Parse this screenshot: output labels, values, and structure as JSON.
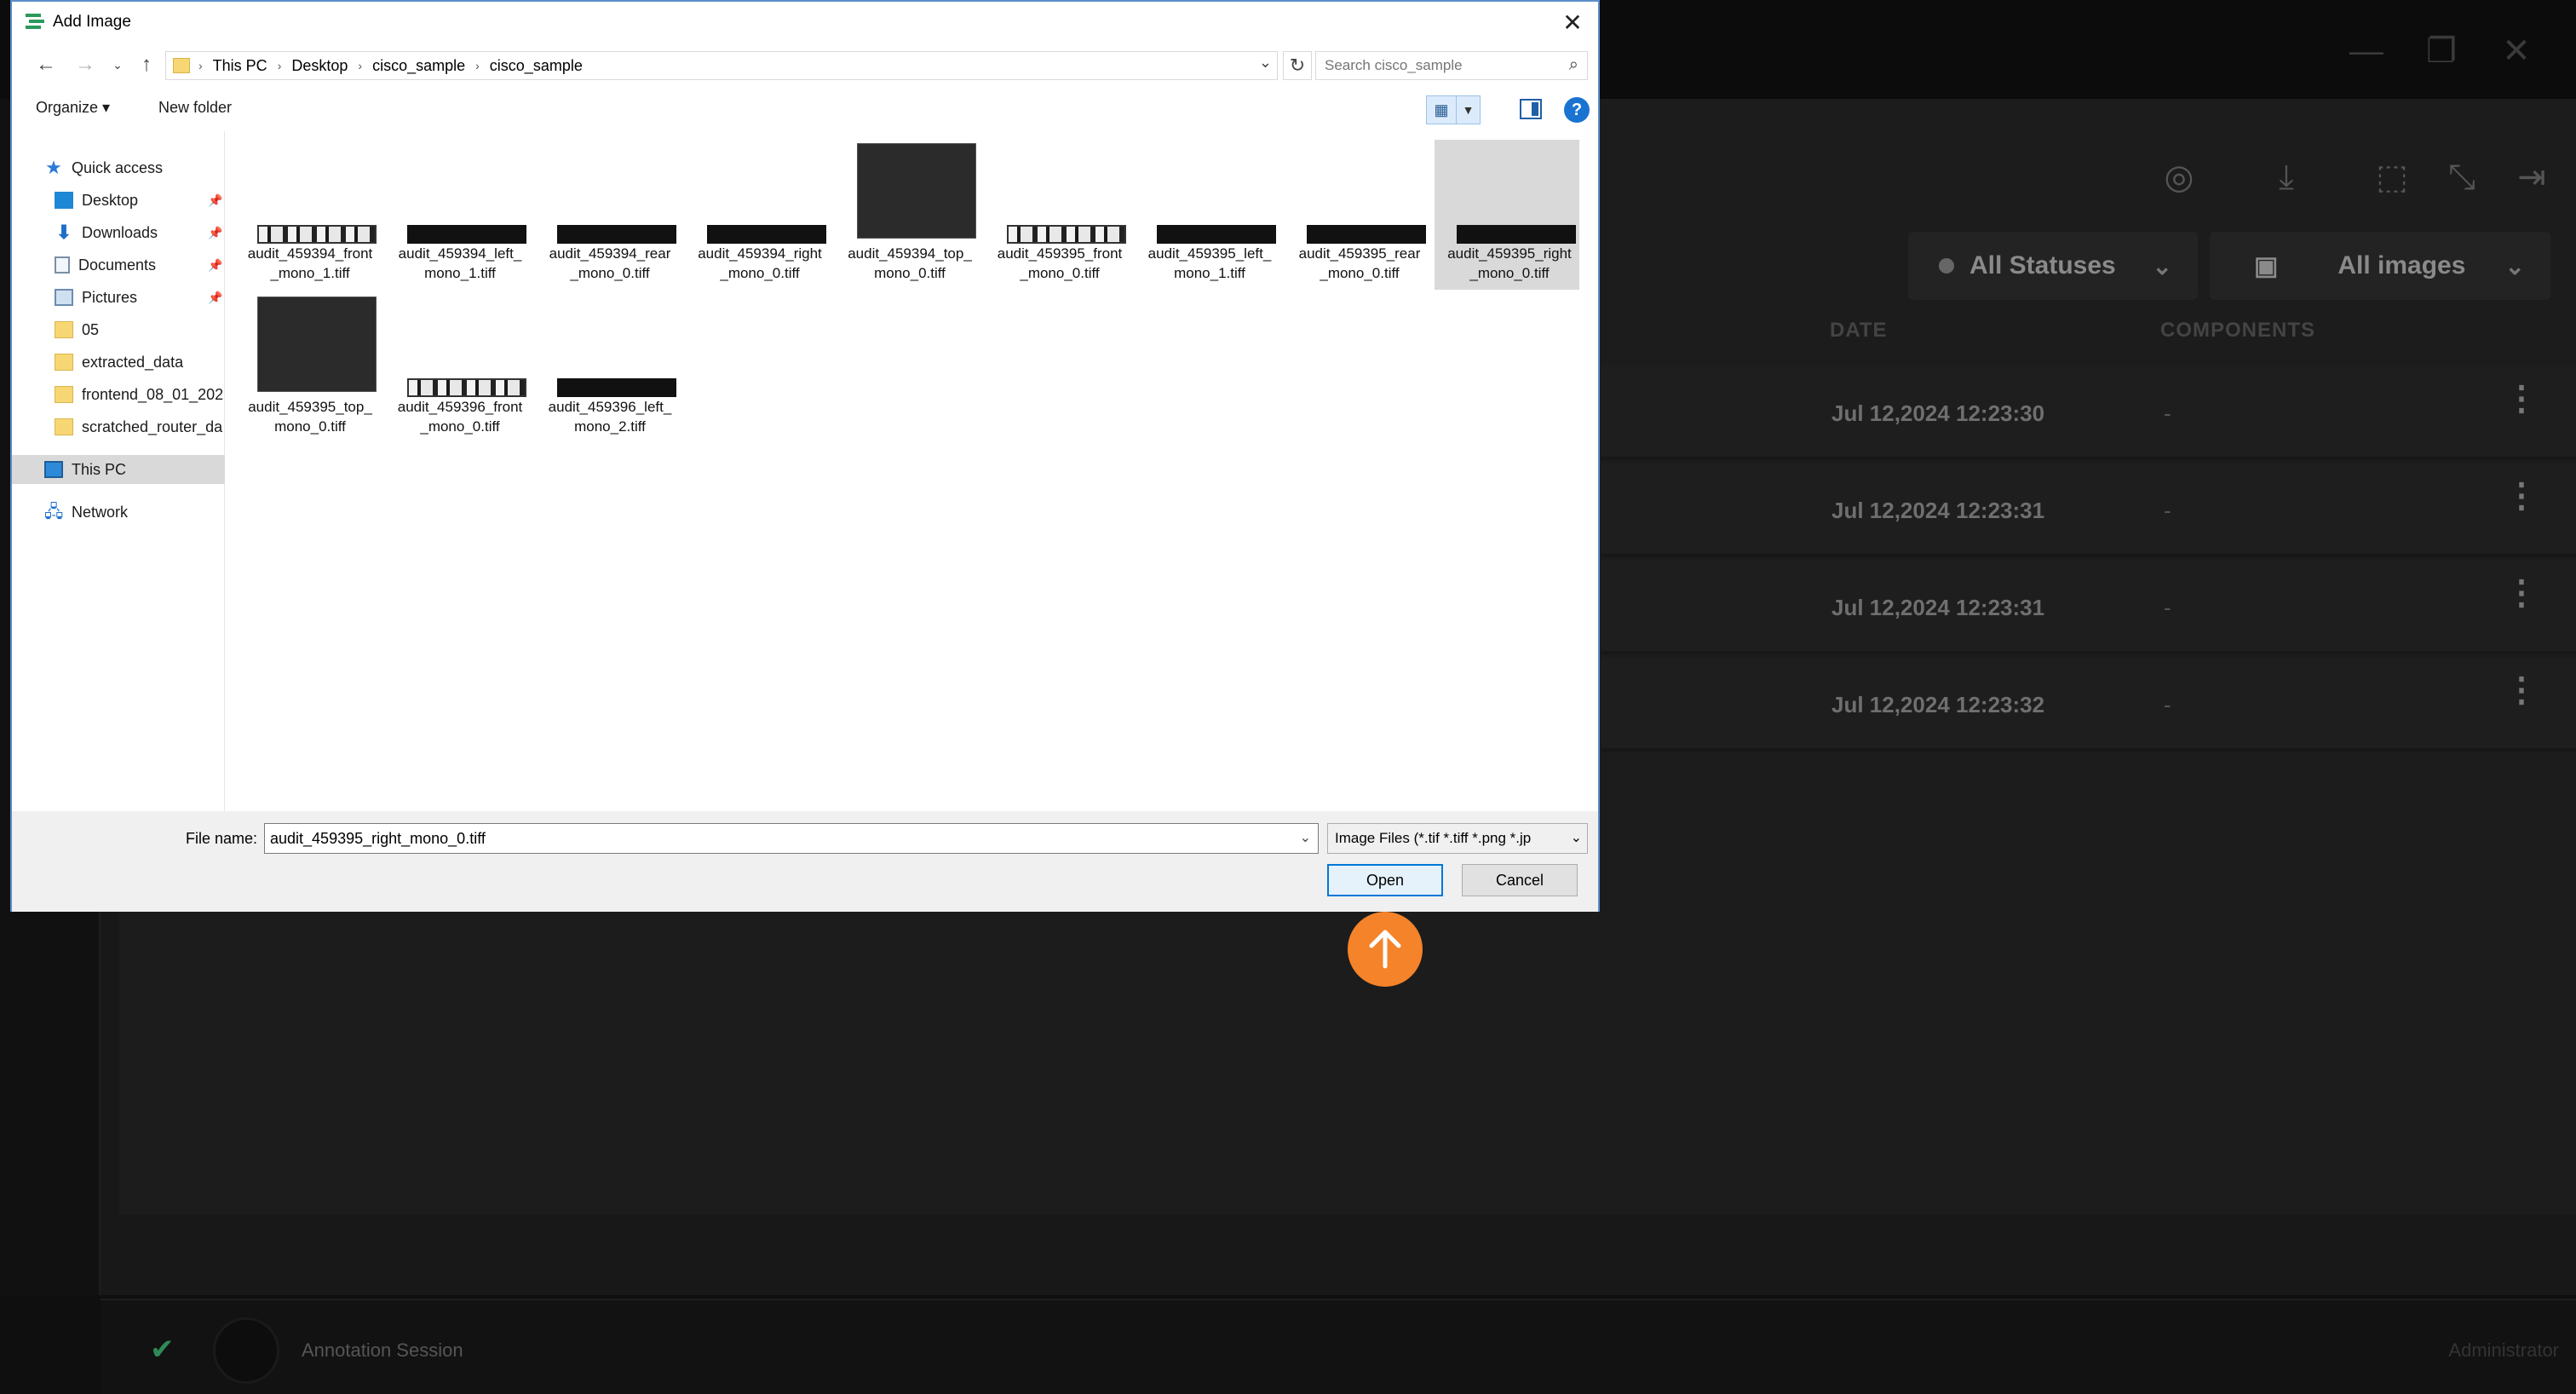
{
  "app": {
    "window_controls": [
      "minimize-icon",
      "restore-icon",
      "close-icon"
    ],
    "toolbar_icons": [
      "compare-icon",
      "download-icon",
      "crop-icon",
      "collapse-icon",
      "shrink-icon"
    ],
    "filters": {
      "status": "All Statuses",
      "images": "All images"
    },
    "columns": {
      "date": "DATE",
      "components": "COMPONENTS"
    },
    "rows": [
      {
        "date": "Jul 12,2024 12:23:30",
        "components": "-"
      },
      {
        "date": "Jul 12,2024 12:23:31",
        "components": "-"
      },
      {
        "date": "Jul 12,2024 12:23:31",
        "components": "-"
      },
      {
        "date": "Jul 12,2024 12:23:32",
        "components": "-"
      }
    ],
    "footer": {
      "session": "Annotation Session",
      "user": "Administrator"
    },
    "accent_color": "#f5832a"
  },
  "dialog": {
    "title": "Add Image",
    "breadcrumb": [
      "This PC",
      "Desktop",
      "cisco_sample",
      "cisco_sample"
    ],
    "search_placeholder": "Search cisco_sample",
    "toolbar": {
      "organize": "Organize ▾",
      "new_folder": "New folder",
      "help": "?"
    },
    "nav": [
      {
        "label": "Quick access",
        "icon": "star-icon",
        "pinned": false
      },
      {
        "label": "Desktop",
        "icon": "desktop-icon",
        "pinned": true
      },
      {
        "label": "Downloads",
        "icon": "download-arrow-icon",
        "pinned": true
      },
      {
        "label": "Documents",
        "icon": "document-icon",
        "pinned": true
      },
      {
        "label": "Pictures",
        "icon": "pictures-icon",
        "pinned": true
      },
      {
        "label": "05",
        "icon": "folder-icon",
        "pinned": false
      },
      {
        "label": "extracted_data",
        "icon": "folder-icon",
        "pinned": false
      },
      {
        "label": "frontend_08_01_202",
        "icon": "folder-icon",
        "pinned": false
      },
      {
        "label": "scratched_router_da",
        "icon": "folder-icon",
        "pinned": false
      },
      {
        "label": "This PC",
        "icon": "computer-icon",
        "pinned": false
      },
      {
        "label": "Network",
        "icon": "network-icon",
        "pinned": false
      }
    ],
    "files": [
      {
        "name": "audit_459394_front_mono_1.tiff",
        "thumb": "light"
      },
      {
        "name": "audit_459394_left_mono_1.tiff",
        "thumb": "dark"
      },
      {
        "name": "audit_459394_rear_mono_0.tiff",
        "thumb": "dark"
      },
      {
        "name": "audit_459394_right_mono_0.tiff",
        "thumb": "dark"
      },
      {
        "name": "audit_459394_top_mono_0.tiff",
        "thumb": "big"
      },
      {
        "name": "audit_459395_front_mono_0.tiff",
        "thumb": "light"
      },
      {
        "name": "audit_459395_left_mono_1.tiff",
        "thumb": "dark"
      },
      {
        "name": "audit_459395_rear_mono_0.tiff",
        "thumb": "dark"
      },
      {
        "name": "audit_459395_right_mono_0.tiff",
        "thumb": "dark"
      },
      {
        "name": "audit_459395_top_mono_0.tiff",
        "thumb": "big"
      },
      {
        "name": "audit_459396_front_mono_0.tiff",
        "thumb": "light"
      },
      {
        "name": "audit_459396_left_mono_2.tiff",
        "thumb": "dark"
      }
    ],
    "selected_file": "audit_459395_right_mono_0.tiff",
    "file_name_label": "File name:",
    "file_name_value": "audit_459395_right_mono_0.tiff",
    "file_type_filter": "Image Files (*.tif *.tiff *.png *.jp",
    "open_label": "Open",
    "cancel_label": "Cancel"
  }
}
